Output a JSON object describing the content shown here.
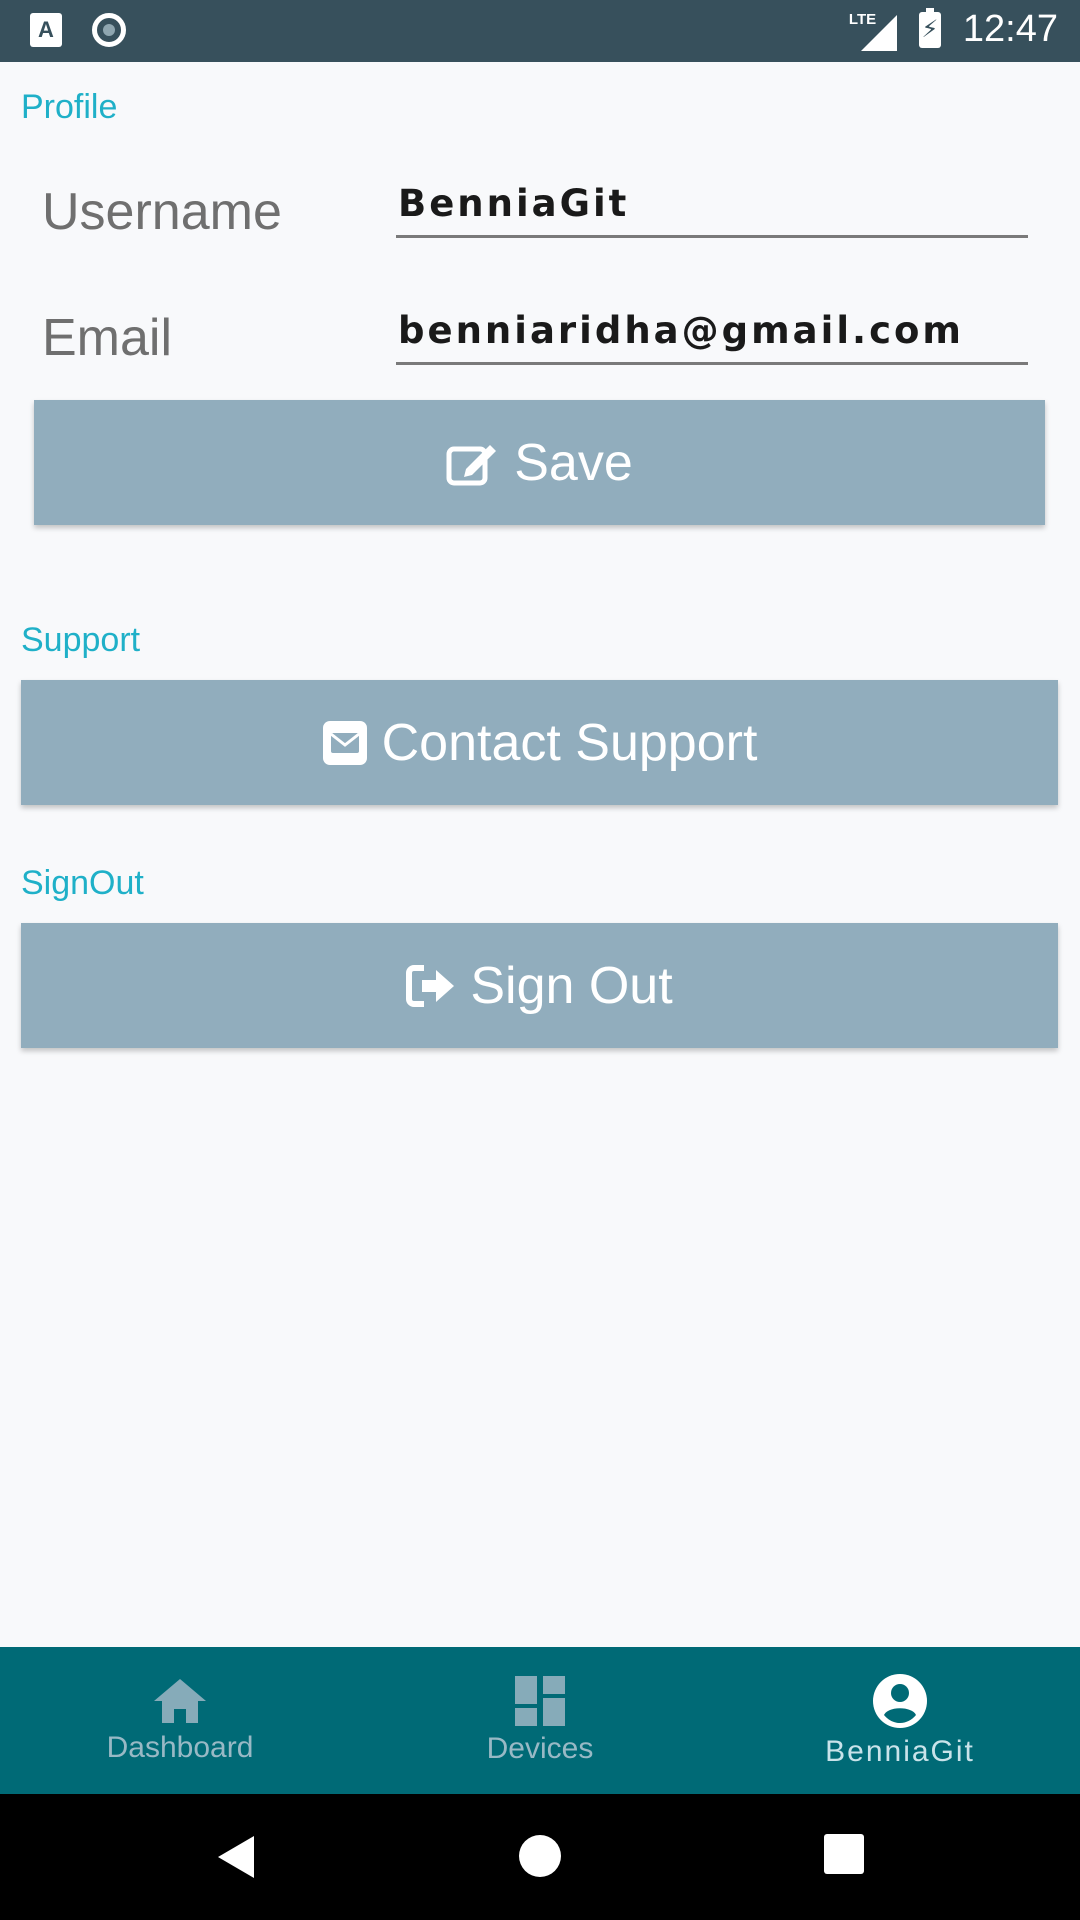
{
  "status_bar": {
    "time": "12:47",
    "network": "LTE",
    "notification_letter": "A"
  },
  "profile": {
    "section_label": "Profile",
    "username_label": "Username",
    "username_value": "BenniaGit",
    "email_label": "Email",
    "email_value": "benniaridha@gmail.com",
    "save_label": "Save"
  },
  "support": {
    "section_label": "Support",
    "button_label": "Contact Support"
  },
  "signout": {
    "section_label": "SignOut",
    "button_label": "Sign Out"
  },
  "bottom_nav": {
    "items": [
      {
        "label": "Dashboard",
        "icon": "home-icon"
      },
      {
        "label": "Devices",
        "icon": "dashboard-grid-icon"
      },
      {
        "label": "BenniaGit",
        "icon": "account-circle-icon",
        "active": true
      }
    ]
  },
  "colors": {
    "accent": "#1fb0c8",
    "button": "#91adbd",
    "status_bar": "#37505c",
    "bottom_nav": "#006a76"
  }
}
